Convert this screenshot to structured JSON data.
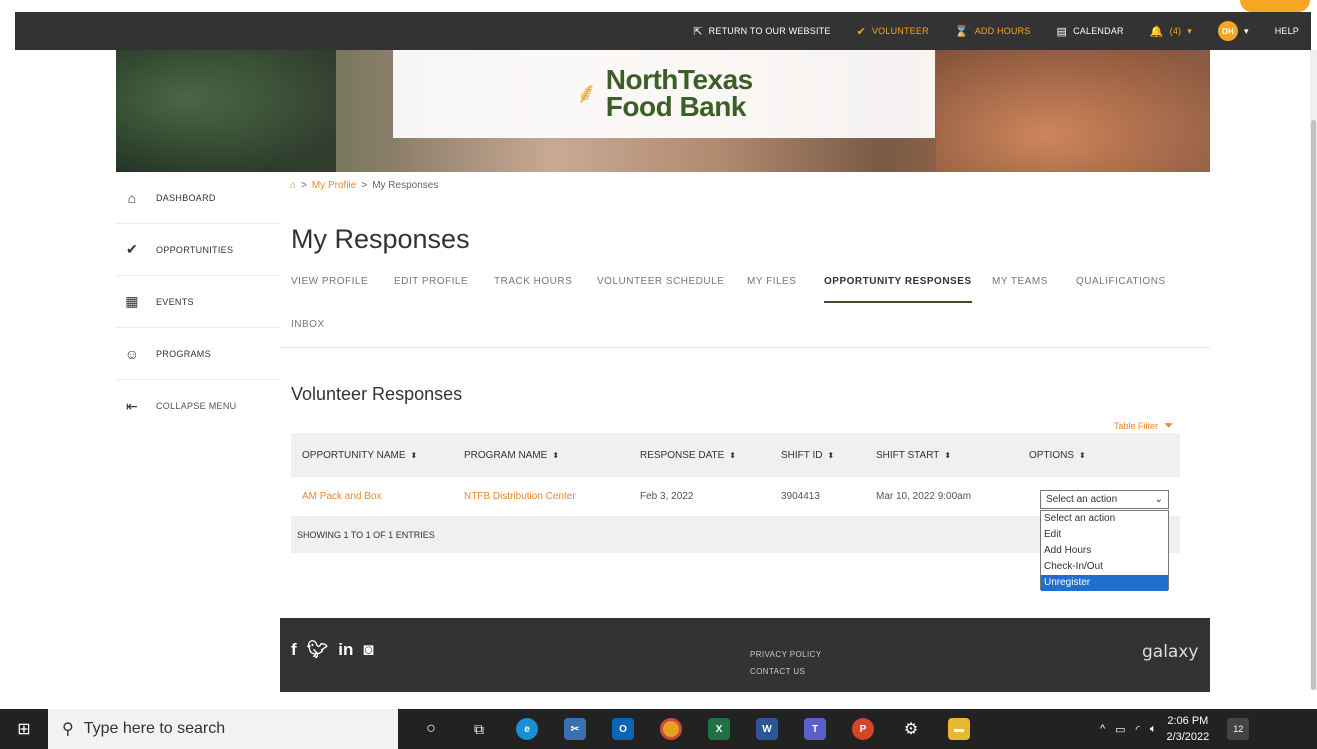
{
  "topbar": {
    "return": "RETURN TO OUR WEBSITE",
    "volunteer": "VOLUNTEER",
    "add_hours": "ADD HOURS",
    "calendar": "CALENDAR",
    "notifications": "(4)",
    "avatar_initials": "DH",
    "help": "HELP"
  },
  "logo": {
    "line1": "NorthTexas",
    "line2": "Food Bank"
  },
  "sidebar": {
    "items": [
      {
        "label": "DASHBOARD",
        "icon": "house-icon"
      },
      {
        "label": "OPPORTUNITIES",
        "icon": "check-circle-icon"
      },
      {
        "label": "EVENTS",
        "icon": "calendar-icon"
      },
      {
        "label": "PROGRAMS",
        "icon": "people-icon"
      },
      {
        "label": "COLLAPSE MENU",
        "icon": "collapse-icon"
      }
    ]
  },
  "breadcrumb": {
    "profile": "My Profile",
    "current": "My Responses",
    "sep": ">"
  },
  "page": {
    "title": "My Responses"
  },
  "tabs": [
    "VIEW PROFILE",
    "EDIT PROFILE",
    "TRACK HOURS",
    "VOLUNTEER SCHEDULE",
    "MY FILES",
    "OPPORTUNITY RESPONSES",
    "MY TEAMS",
    "QUALIFICATIONS",
    "INBOX"
  ],
  "section": {
    "title": "Volunteer Responses",
    "table_filter": "Table Filter"
  },
  "table": {
    "headers": [
      "OPPORTUNITY NAME",
      "PROGRAM NAME",
      "RESPONSE DATE",
      "SHIFT ID",
      "SHIFT START",
      "OPTIONS"
    ],
    "rows": [
      [
        "AM Pack and Box",
        "NTFB Distribution Center",
        "Feb 3, 2022",
        "3904413",
        "Mar 10, 2022 9:00am"
      ]
    ],
    "footer": "SHOWING 1 TO 1 OF 1 ENTRIES"
  },
  "action_select": {
    "value": "Select an action",
    "options": [
      "Select an action",
      "Edit",
      "Add Hours",
      "Check-In/Out",
      "Unregister"
    ],
    "highlighted": "Unregister"
  },
  "footer": {
    "privacy": "PRIVACY POLICY",
    "contact": "CONTACT US",
    "brand": "galaxy"
  },
  "taskbar": {
    "search_placeholder": "Type here to search",
    "time": "2:06 PM",
    "date": "2/3/2022",
    "notification_count": "12"
  },
  "colors": {
    "accent": "#f5a623",
    "link": "#e8892f",
    "dark": "#333333",
    "logo_green": "#3b5f27",
    "selection": "#1e6fd0"
  }
}
